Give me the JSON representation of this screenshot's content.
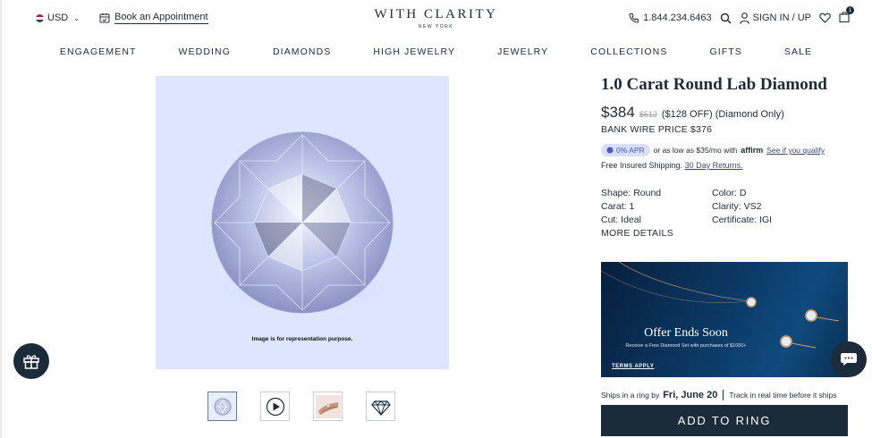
{
  "header": {
    "currency": "USD",
    "appointment_label": "Book an Appointment",
    "logo_main": "WITH CLARITY",
    "logo_sub": "NEW YORK",
    "phone": "1.844.234.6463",
    "signin_label": "SIGN IN / UP",
    "cart_count": "1",
    "icons": [
      "flag-us-icon",
      "chevron-down-icon",
      "calendar-icon",
      "phone-icon",
      "search-icon",
      "user-icon",
      "heart-icon",
      "bag-icon"
    ]
  },
  "nav": {
    "items": [
      "ENGAGEMENT",
      "WEDDING",
      "DIAMONDS",
      "HIGH JEWELRY",
      "JEWELRY",
      "COLLECTIONS",
      "GIFTS",
      "SALE"
    ]
  },
  "gallery": {
    "caption": "Image is for representation purpose.",
    "thumbnails": [
      "diamond-thumb",
      "video-play-thumb",
      "hand-ring-thumb",
      "diamond-outline-thumb"
    ],
    "background": "#dde6ff"
  },
  "product": {
    "title": "1.0 Carat Round Lab Diamond",
    "price": "$384",
    "old_price": "$512",
    "discount_note": "($128 OFF) (Diamond Only)",
    "bank_wire": "BANK WIRE PRICE $376",
    "affirm": {
      "apr_badge": "0% APR",
      "text": "or as low as $35/mo with",
      "logo": "affirm",
      "link": "See if you qualify"
    },
    "shipping_text": "Free Insured Shipping.",
    "returns_link": "30 Day Returns.",
    "specs": {
      "shape": "Shape: Round",
      "color": "Color: D",
      "carat": "Carat: 1",
      "clarity": "Clarity: VS2",
      "cut": "Cut: Ideal",
      "certificate": "Certificate: IGI"
    },
    "more_details": "MORE DETAILS"
  },
  "promo": {
    "title": "Offer Ends Soon",
    "subtitle": "Receive a Free Diamond Set with purchases of $1000+",
    "terms": "TERMS APPLY"
  },
  "shipping_ring": {
    "prefix": "Ships in a ring by",
    "date": "Fri, June 20",
    "track": "Track in real time before it ships"
  },
  "cta": {
    "add_to_ring": "ADD TO RING"
  },
  "colors": {
    "brand_navy": "#1c2b3a",
    "apr_badge_bg": "#d8defc",
    "apr_badge_text": "#4a56c9"
  }
}
